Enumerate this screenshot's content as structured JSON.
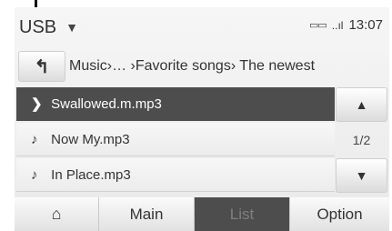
{
  "header": {
    "source_label": "USB",
    "source_caret": "▼",
    "battery_icon": "▭▭",
    "signal_icon": "..ıl",
    "time": "13:07"
  },
  "path_bar": {
    "up_icon": "↰",
    "path_text": "Music›… ›Favorite songs› The newest"
  },
  "list": {
    "items": [
      {
        "glyph": "❯",
        "label": "Swallowed.m.mp3",
        "active": true
      },
      {
        "glyph": "♪",
        "label": "Now My.mp3",
        "active": false
      },
      {
        "glyph": "♪",
        "label": "In Place.mp3",
        "active": false
      }
    ],
    "page": "1/2",
    "scroll_up_icon": "▲",
    "scroll_down_icon": "▼"
  },
  "tabs": {
    "home_icon": "⌂",
    "main": "Main",
    "list": "List",
    "option": "Option"
  }
}
